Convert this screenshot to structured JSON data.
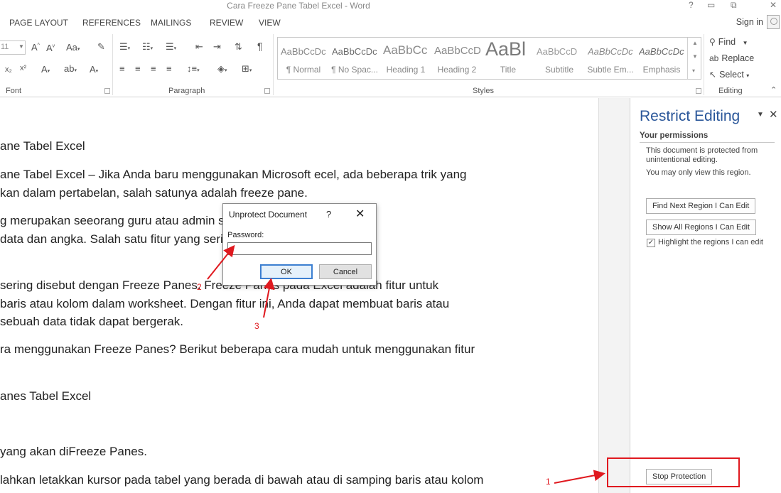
{
  "window": {
    "title": "Cara Freeze Pane Tabel Excel - Word",
    "help": "?",
    "restore": "▭",
    "minimize": "⧉",
    "close": "✕"
  },
  "tabs": [
    "PAGE LAYOUT",
    "REFERENCES",
    "MAILINGS",
    "REVIEW",
    "VIEW"
  ],
  "signin": "Sign in",
  "ribbon": {
    "font_size": "11",
    "groups": [
      "Font",
      "Paragraph",
      "Styles",
      "Editing"
    ],
    "styles": [
      {
        "sample": "AaBbCcDc",
        "name": "¶ Normal"
      },
      {
        "sample": "AaBbCcDc",
        "name": "¶ No Spac..."
      },
      {
        "sample": "AaBbCc",
        "name": "Heading 1"
      },
      {
        "sample": "AaBbCcD",
        "name": "Heading 2"
      },
      {
        "sample": "AaBl",
        "name": "Title"
      },
      {
        "sample": "AaBbCcD",
        "name": "Subtitle"
      },
      {
        "sample": "AaBbCcDc",
        "name": "Subtle Em..."
      },
      {
        "sample": "AaBbCcDc",
        "name": "Emphasis"
      }
    ],
    "editing": {
      "find": "Find",
      "replace": "Replace",
      "select": "Select"
    }
  },
  "document": {
    "lines": [
      "ane Tabel Excel",
      "ane Tabel Excel – Jika Anda baru menggunakan Microsoft ecel, ada beberapa trik yang",
      "kan dalam pertabelan, salah satunya adalah freeze pane.",
      "g merupakan seeorang guru atau admin                                    sering berkecimpung",
      "data dan angka. Salah satu fitur yang seri                                   bekukan kolom atau",
      " sering disebut dengan Freeze Panes. Freeze Panes pada Excel adalah fitur untuk",
      " baris atau kolom dalam worksheet. Dengan fitur ini, Anda dapat membuat baris atau",
      "sebuah data tidak dapat bergerak.",
      "ra menggunakan Freeze Panes? Berikut beberapa cara mudah untuk menggunakan fitur",
      "anes Tabel Excel",
      "yang akan diFreeze Panes.",
      "lahkan letakkan kursor pada tabel yang berada di bawah atau di samping baris atau kolom"
    ]
  },
  "pane": {
    "title": "Restrict Editing",
    "permissions_heading": "Your permissions",
    "protected_text": "This document is protected from unintentional editing.",
    "view_text": "You may only view this region.",
    "find_next": "Find Next Region I Can Edit",
    "show_all": "Show All Regions I Can Edit",
    "highlight": "Highlight the regions I can edit",
    "highlight_checked": true,
    "stop_protection": "Stop Protection"
  },
  "dialog": {
    "title": "Unprotect Document",
    "help": "?",
    "close": "✕",
    "password_label": "Password:",
    "password_value": "",
    "ok": "OK",
    "cancel": "Cancel"
  },
  "annotations": {
    "color": "#e0191f",
    "step1": "1",
    "step2": "2",
    "step3": "3"
  },
  "colors": {
    "pane_title": "#2b579a",
    "ok_border": "#3c7fd1"
  }
}
